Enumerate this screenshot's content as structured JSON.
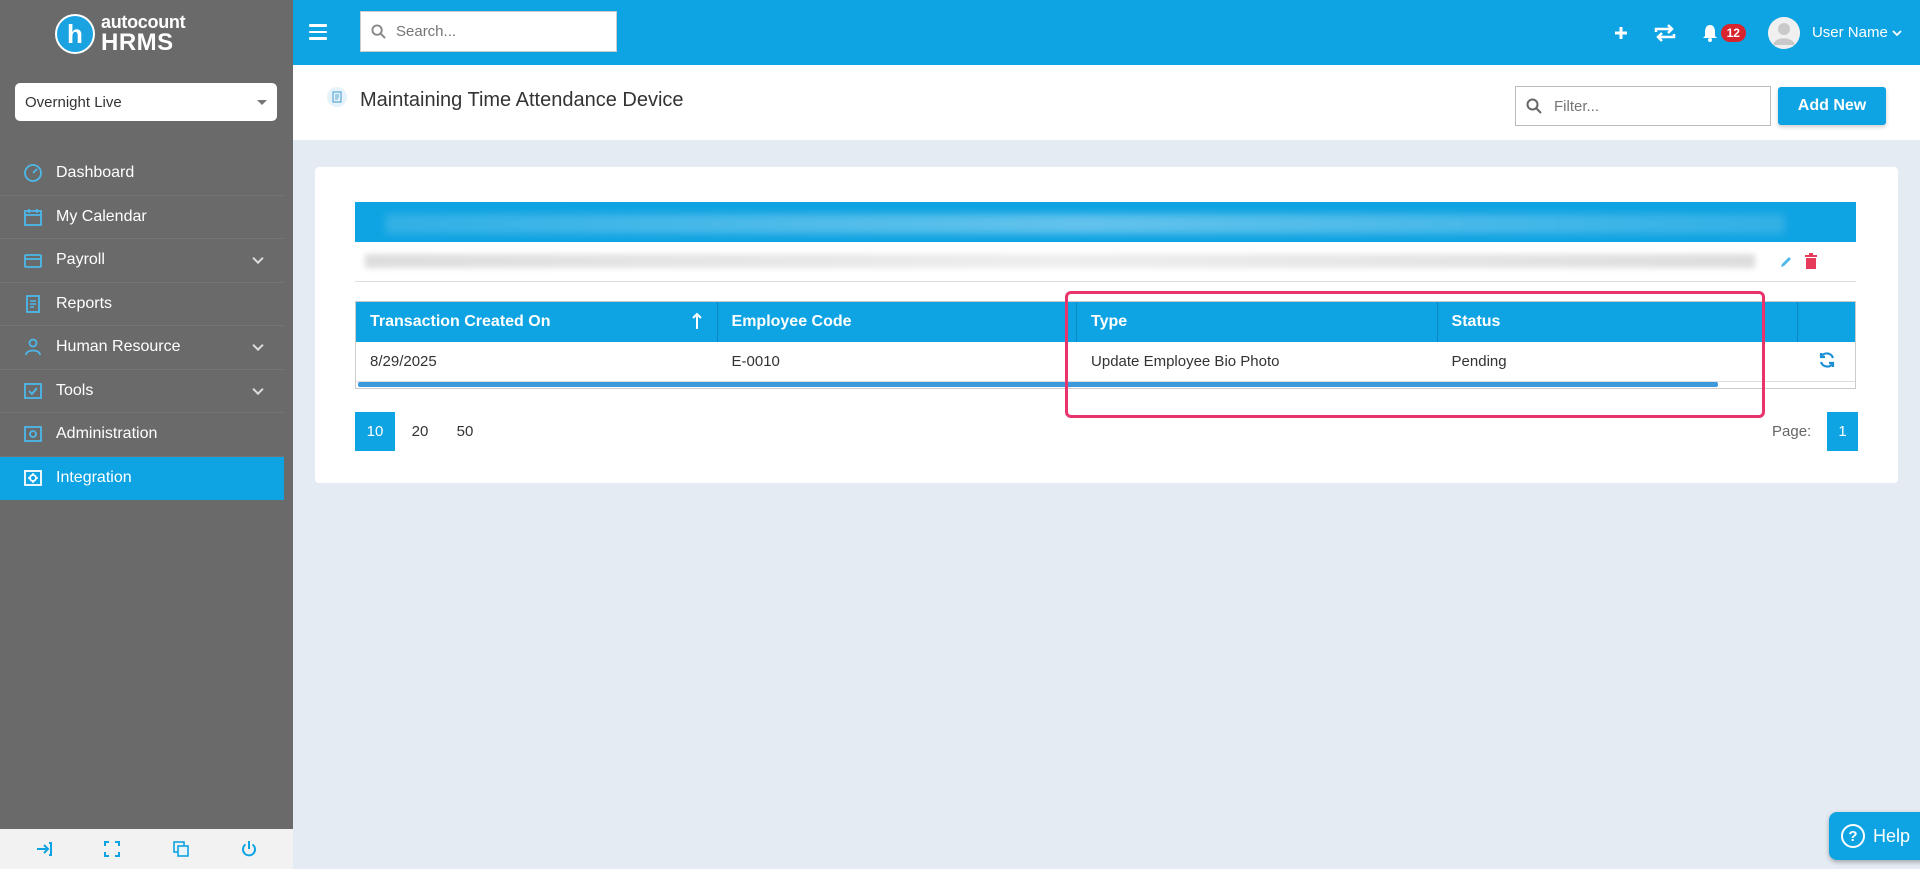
{
  "brand": {
    "top": "autocount",
    "bottom": "HRMS",
    "mark": "h"
  },
  "company": {
    "selected": "Overnight Live"
  },
  "sidebar": {
    "items": [
      {
        "label": "Dashboard",
        "icon": "dashboard-icon",
        "expandable": false
      },
      {
        "label": "My Calendar",
        "icon": "calendar-icon",
        "expandable": false
      },
      {
        "label": "Payroll",
        "icon": "payroll-icon",
        "expandable": true
      },
      {
        "label": "Reports",
        "icon": "reports-icon",
        "expandable": false
      },
      {
        "label": "Human Resource",
        "icon": "human-resource-icon",
        "expandable": true
      },
      {
        "label": "Tools",
        "icon": "tools-icon",
        "expandable": true
      },
      {
        "label": "Administration",
        "icon": "administration-icon",
        "expandable": false
      },
      {
        "label": "Integration",
        "icon": "integration-icon",
        "expandable": false,
        "active": true
      }
    ]
  },
  "topbar": {
    "search_placeholder": "Search...",
    "notification_count": "12",
    "user_name": "User Name"
  },
  "page": {
    "title": "Maintaining Time Attendance Device",
    "filter_placeholder": "Filter...",
    "add_new_label": "Add New"
  },
  "detail_grid": {
    "columns": [
      "Transaction Created On",
      "Employee Code",
      "Type",
      "Status"
    ],
    "rows": [
      {
        "created_on": "8/29/2025",
        "employee_code": "E-0010",
        "type": "Update Employee Bio Photo",
        "status": "Pending"
      }
    ]
  },
  "pager": {
    "sizes": [
      "10",
      "20",
      "50"
    ],
    "active_size": "10",
    "page_label": "Page:",
    "current_page": "1"
  },
  "help": {
    "label": "Help"
  },
  "colors": {
    "accent": "#0ea3e2",
    "sidebar": "#6a6a6a",
    "highlight": "#e8336b",
    "delete": "#e63a5a"
  }
}
